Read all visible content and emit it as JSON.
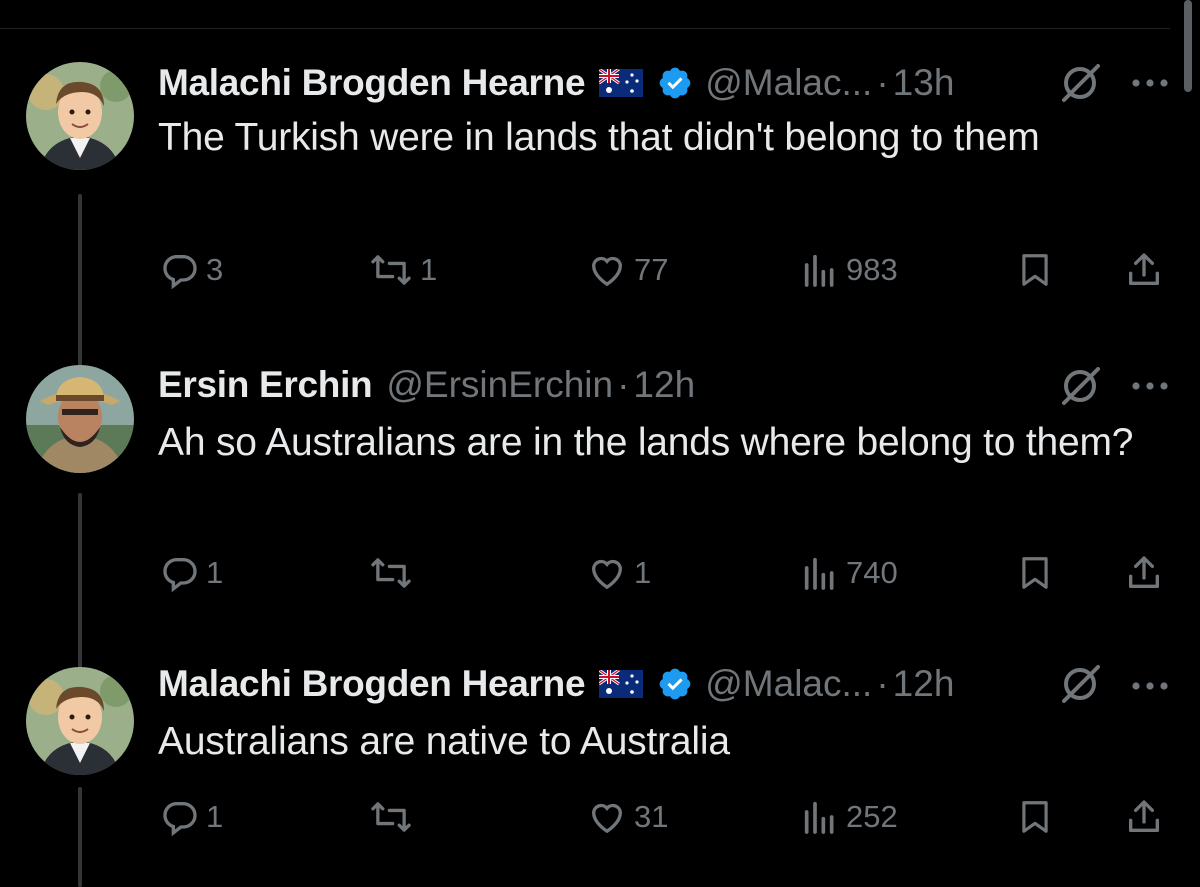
{
  "tweets": [
    {
      "author_name": "Malachi Brogden Hearne",
      "flag_icon": "australia-flag-icon",
      "verified_icon": "verified-badge-icon",
      "handle": "@Malac...",
      "separator": "·",
      "time": "13h",
      "text": "The Turkish were in lands that didn't belong to them",
      "replies": "3",
      "reposts": "1",
      "likes": "77",
      "views": "983"
    },
    {
      "author_name": "Ersin Erchin",
      "handle": "@ErsinErchin",
      "separator": "·",
      "time": "12h",
      "text": "Ah so Australians are in the lands where belong to them?",
      "replies": "1",
      "reposts": "",
      "likes": "1",
      "views": "740"
    },
    {
      "author_name": "Malachi Brogden Hearne",
      "flag_icon": "australia-flag-icon",
      "verified_icon": "verified-badge-icon",
      "handle": "@Malac...",
      "separator": "·",
      "time": "12h",
      "text": "Australians are native to Australia",
      "replies": "1",
      "reposts": "",
      "likes": "31",
      "views": "252"
    }
  ],
  "colors": {
    "background": "#000000",
    "text_primary": "#e7e9ea",
    "text_secondary": "#71767b",
    "verified_blue": "#1d9bf0",
    "thread_line": "#333639"
  }
}
